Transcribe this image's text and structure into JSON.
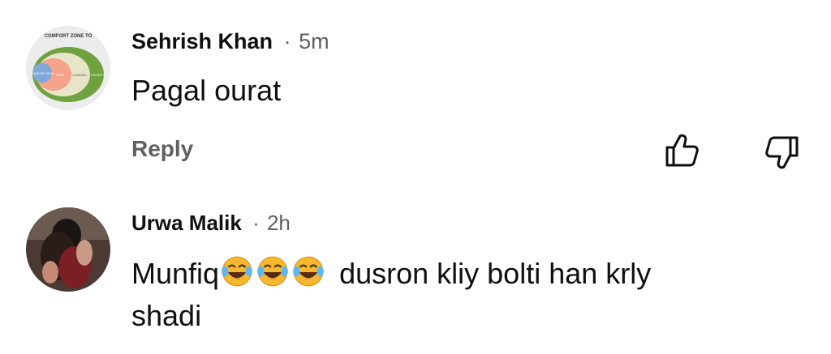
{
  "comments": [
    {
      "author": "Sehrish Khan",
      "separator": "·",
      "time": "5m",
      "text": "Pagal ourat",
      "reply_label": "Reply",
      "avatar_text": "COMFORT ZONE TO",
      "avatar_zones": [
        "COMFORT ZONE",
        "FEAR",
        "LEARNING",
        "GROWTH"
      ],
      "icons": [
        "thumbs-up-icon",
        "thumbs-down-icon"
      ]
    },
    {
      "author": "Urwa Malik",
      "separator": "·",
      "time": "2h",
      "text_before": "Munfiq",
      "emoji": [
        "😂",
        "😂",
        "😂"
      ],
      "text_after": "dusron kliy bolti han krly",
      "text_line2": "shadi"
    }
  ],
  "colors": {
    "primary_text": "#0f0f0f",
    "secondary_text": "#606060",
    "background": "#ffffff"
  }
}
